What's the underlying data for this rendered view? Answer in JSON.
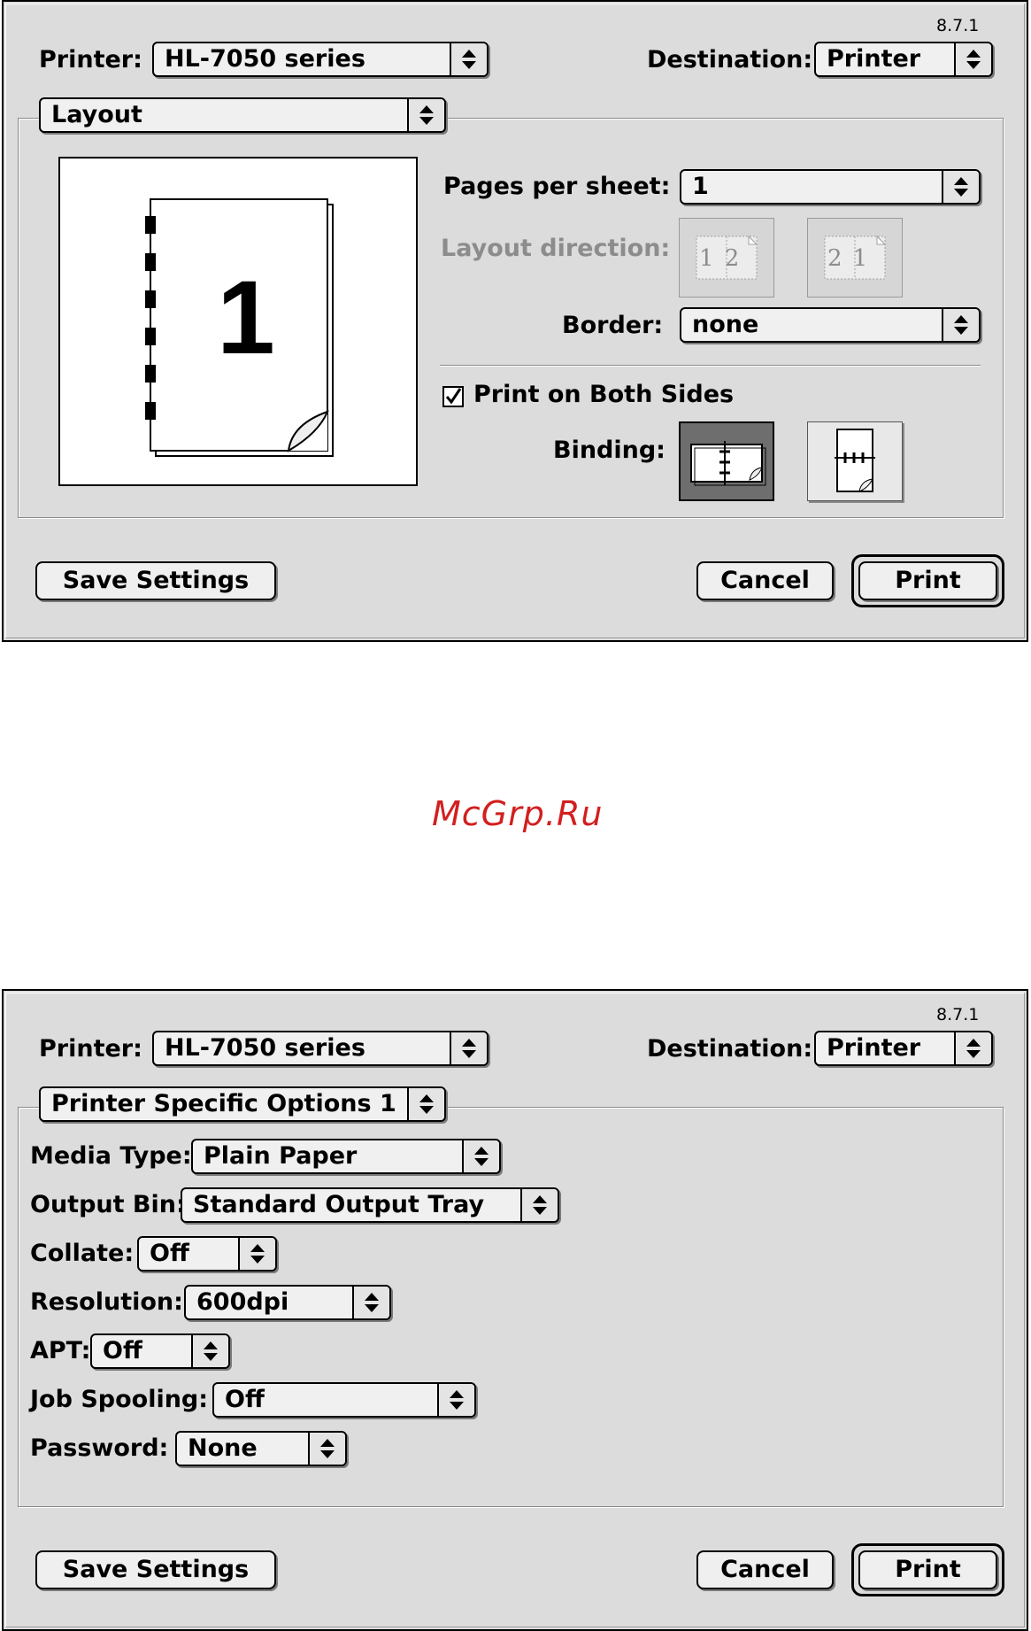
{
  "version": "8.7.1",
  "printer": {
    "label": "Printer:",
    "value": "HL-7050 series"
  },
  "destination": {
    "label": "Destination:",
    "value": "Printer"
  },
  "buttons": {
    "save": "Save Settings",
    "cancel": "Cancel",
    "print": "Print"
  },
  "layout_panel": {
    "panel_select": "Layout",
    "preview_page_number": "1",
    "pages_per_sheet": {
      "label": "Pages per sheet:",
      "value": "1"
    },
    "layout_direction": {
      "label": "Layout direction:",
      "option_ltr": "1 2",
      "option_rtl": "2 1"
    },
    "border": {
      "label": "Border:",
      "value": "none"
    },
    "print_both_sides": {
      "label": "Print on Both Sides",
      "checked": true
    },
    "binding": {
      "label": "Binding:"
    }
  },
  "watermark": "McGrp.Ru",
  "specific_panel": {
    "panel_select": "Printer Specific Options 1",
    "options": [
      {
        "label": "Media Type:",
        "value": "Plain Paper"
      },
      {
        "label": "Output Bin:",
        "value": "Standard Output Tray"
      },
      {
        "label": "Collate:",
        "value": "Off"
      },
      {
        "label": "Resolution:",
        "value": "600dpi"
      },
      {
        "label": "APT:",
        "value": "Off"
      },
      {
        "label": "Job Spooling:",
        "value": "Off"
      },
      {
        "label": "Password:",
        "value": "None"
      }
    ]
  }
}
